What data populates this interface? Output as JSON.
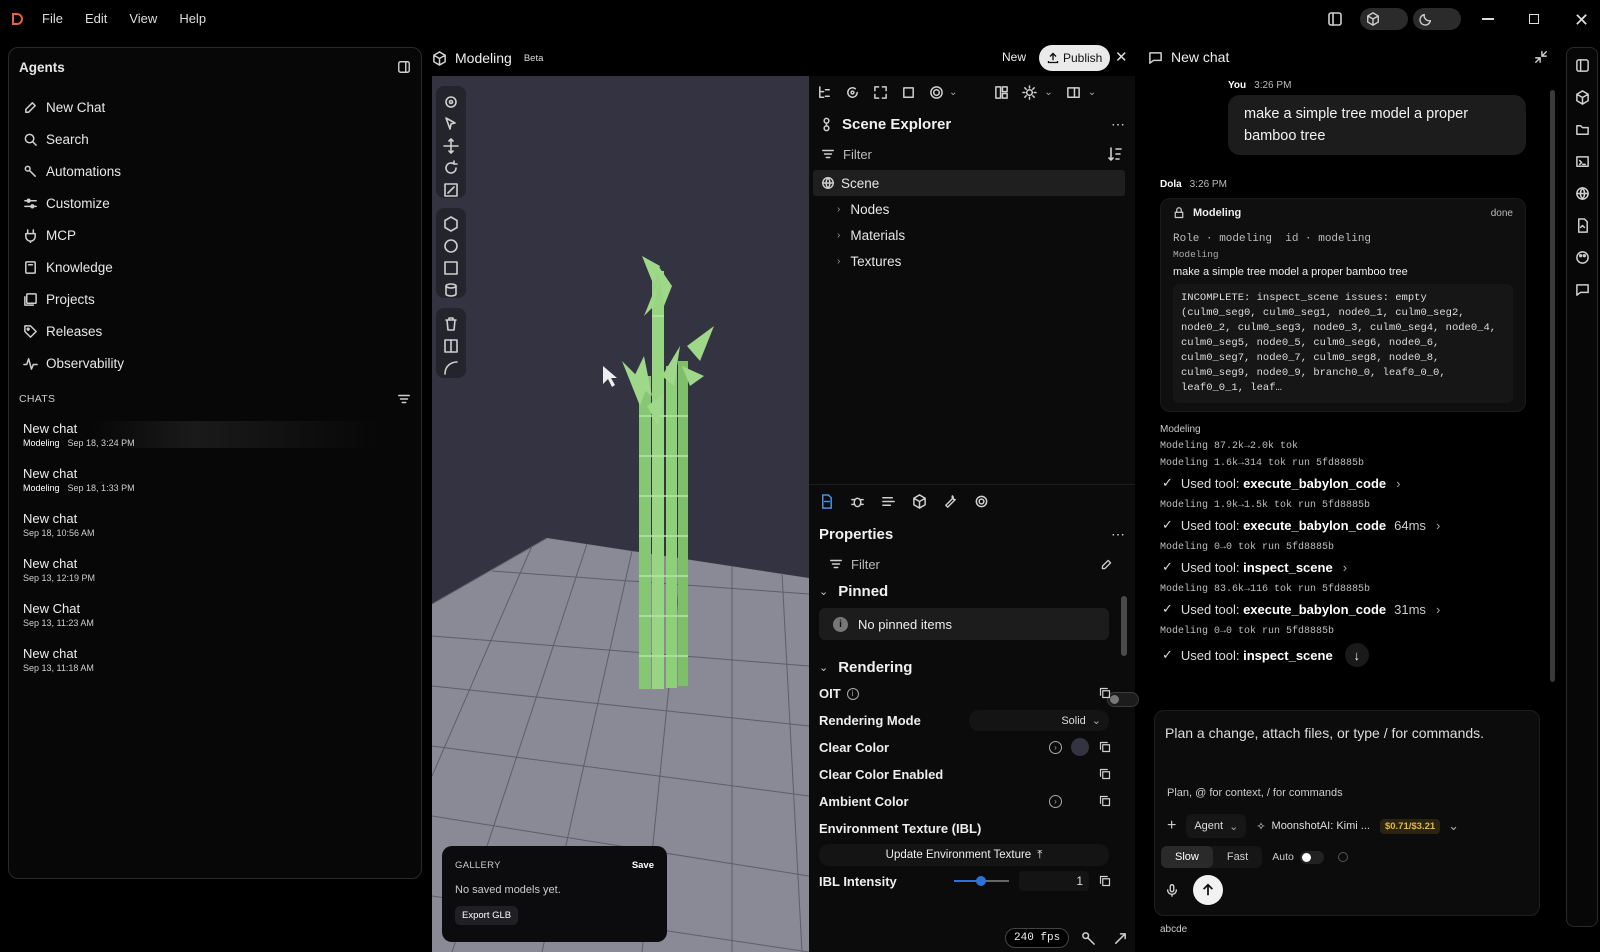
{
  "menu": {
    "file": "File",
    "edit": "Edit",
    "view": "View",
    "help": "Help"
  },
  "sidebar": {
    "title": "Agents",
    "items": [
      {
        "label": "New Chat",
        "icon": "edit-icon"
      },
      {
        "label": "Search",
        "icon": "search-icon"
      },
      {
        "label": "Automations",
        "icon": "automation-icon"
      },
      {
        "label": "Customize",
        "icon": "sliders-icon"
      },
      {
        "label": "MCP",
        "icon": "plug-icon"
      },
      {
        "label": "Knowledge",
        "icon": "book-icon"
      },
      {
        "label": "Projects",
        "icon": "folder-icon"
      },
      {
        "label": "Releases",
        "icon": "tag-icon"
      },
      {
        "label": "Observability",
        "icon": "pulse-icon"
      }
    ],
    "chats_heading": "CHATS",
    "chats": [
      {
        "title": "New chat",
        "tag": "Modeling",
        "date": "Sep 18, 3:24 PM"
      },
      {
        "title": "New chat",
        "tag": "Modeling",
        "date": "Sep 18, 1:33 PM"
      },
      {
        "title": "New chat",
        "tag": "",
        "date": "Sep 18, 10:56 AM"
      },
      {
        "title": "New chat",
        "tag": "",
        "date": "Sep 13, 12:19 PM"
      },
      {
        "title": "New Chat",
        "tag": "",
        "date": "Sep 13, 11:23 AM"
      },
      {
        "title": "New chat",
        "tag": "",
        "date": "Sep 13, 11:18 AM"
      }
    ]
  },
  "modeling": {
    "title": "Modeling",
    "badge": "Beta",
    "new_label": "New",
    "publish_label": "Publish"
  },
  "gallery": {
    "heading": "GALLERY",
    "save": "Save",
    "empty": "No saved models yet.",
    "export": "Export GLB"
  },
  "scene_explorer": {
    "title": "Scene Explorer",
    "filter": "Filter",
    "root": "Scene",
    "children": [
      "Nodes",
      "Materials",
      "Textures"
    ]
  },
  "properties": {
    "title": "Properties",
    "filter": "Filter",
    "pinned": "Pinned",
    "no_pinned": "No pinned items",
    "rendering": "Rendering",
    "oit": "OIT",
    "rendering_mode": "Rendering Mode",
    "rendering_mode_value": "Solid",
    "clear_color": "Clear Color",
    "clear_color_enabled": "Clear Color Enabled",
    "ambient_color": "Ambient Color",
    "env_texture": "Environment Texture (IBL)",
    "update_env": "Update Environment Texture",
    "ibl_intensity": "IBL Intensity",
    "ibl_value": "1",
    "fps": "240 fps"
  },
  "chat": {
    "title": "New chat",
    "user_name": "You",
    "user_time": "3:26 PM",
    "user_message": "make a simple tree model a proper bamboo tree",
    "agent_name": "Dola",
    "agent_time": "3:26 PM",
    "card_title": "Modeling",
    "card_status": "done",
    "card_role": "Role · modeling  id · modeling",
    "card_sub": "Modeling",
    "card_task": "make a simple tree model a proper bamboo tree",
    "card_result": "INCOMPLETE: inspect_scene issues: empty (culm0_seg0, culm0_seg1, node0_1, culm0_seg2, node0_2, culm0_seg3, node0_3, culm0_seg4, node0_4, culm0_seg5, node0_5, culm0_seg6, node0_6, culm0_seg7, node0_7, culm0_seg8, node0_8, culm0_seg9, node0_9, branch0_0, leaf0_0_0, leaf0_0_1, leaf…",
    "section": "Modeling",
    "log_lines": [
      {
        "text": "Modeling 87.2k→2.0k tok",
        "tool": "",
        "time": ""
      },
      {
        "text": "Modeling 1.6k→314 tok run 5fd8885b",
        "tool": "execute_babylon_code",
        "time": ""
      },
      {
        "text": "Modeling 1.9k→1.5k tok run 5fd8885b",
        "tool": "execute_babylon_code",
        "time": "64ms"
      },
      {
        "text": "Modeling 0→0 tok run 5fd8885b",
        "tool": "inspect_scene",
        "time": ""
      },
      {
        "text": "Modeling 83.6k→116 tok run 5fd8885b",
        "tool": "execute_babylon_code",
        "time": "31ms"
      },
      {
        "text": "Modeling 0→0 tok run 5fd8885b",
        "tool": "inspect_scene",
        "time": ""
      }
    ],
    "used_tool": "Used tool:",
    "input_placeholder": "Plan a change, attach files, or type / for commands.",
    "hint": "Plan, @ for context, / for commands",
    "agent_select": "Agent",
    "model": "MoonshotAI: Kimi ...",
    "cost": "$0.71/$3.21",
    "slow": "Slow",
    "fast": "Fast",
    "auto": "Auto",
    "footer": "abcde"
  },
  "colors": {
    "accent": "#2a73d9",
    "viewport": "#333342",
    "bamboo": "#8fd17a",
    "cost": "#e5b83a"
  }
}
